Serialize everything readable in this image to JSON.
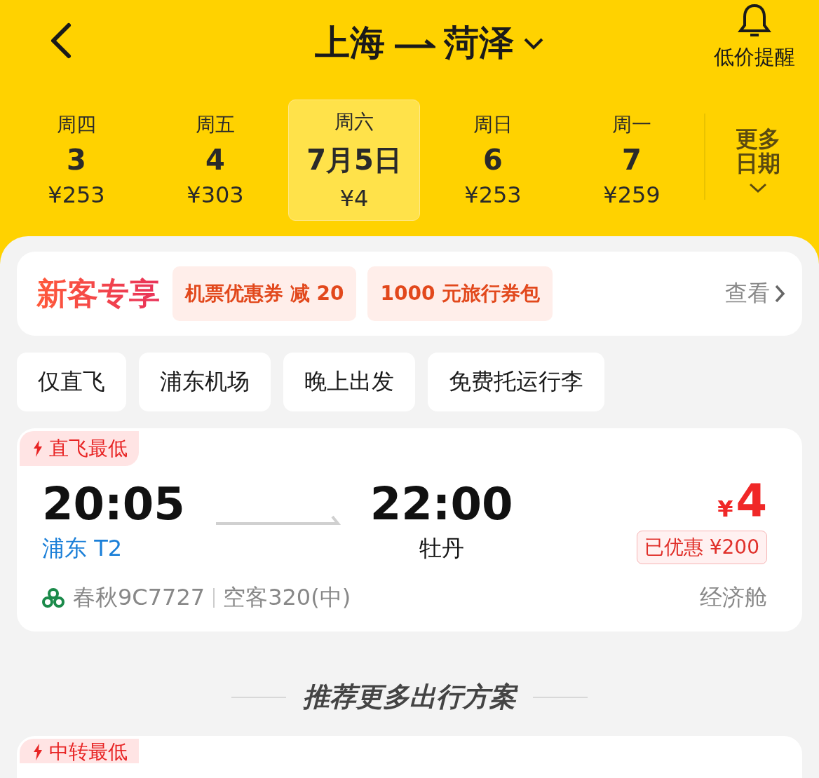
{
  "header": {
    "from": "上海",
    "to": "菏泽",
    "alert_label": "低价提醒"
  },
  "dates": [
    {
      "weekday": "周四",
      "day": "3",
      "price": "¥253",
      "selected": false
    },
    {
      "weekday": "周五",
      "day": "4",
      "price": "¥303",
      "selected": false
    },
    {
      "weekday": "周六",
      "day": "7月5日",
      "price": "¥4",
      "selected": true
    },
    {
      "weekday": "周日",
      "day": "6",
      "price": "¥253",
      "selected": false
    },
    {
      "weekday": "周一",
      "day": "7",
      "price": "¥259",
      "selected": false
    }
  ],
  "more_dates": "更多日期",
  "promo": {
    "title": "新客专享",
    "coupons": [
      "机票优惠券 减 20",
      "1000 元旅行券包"
    ],
    "view": "查看"
  },
  "filters": [
    "仅直飞",
    "浦东机场",
    "晚上出发",
    "免费托运行李"
  ],
  "flight": {
    "tag": "直飞最低",
    "depart_time": "20:05",
    "arrive_time": "22:00",
    "depart_airport": "浦东 T2",
    "arrive_airport": "牡丹",
    "price_symbol": "¥",
    "price": "4",
    "discount": "已优惠 ¥200",
    "airline": "春秋9C7727",
    "aircraft": "空客320(中)",
    "cabin": "经济舱"
  },
  "section_title": "推荐更多出行方案",
  "next_card": {
    "tag": "中转最低"
  }
}
